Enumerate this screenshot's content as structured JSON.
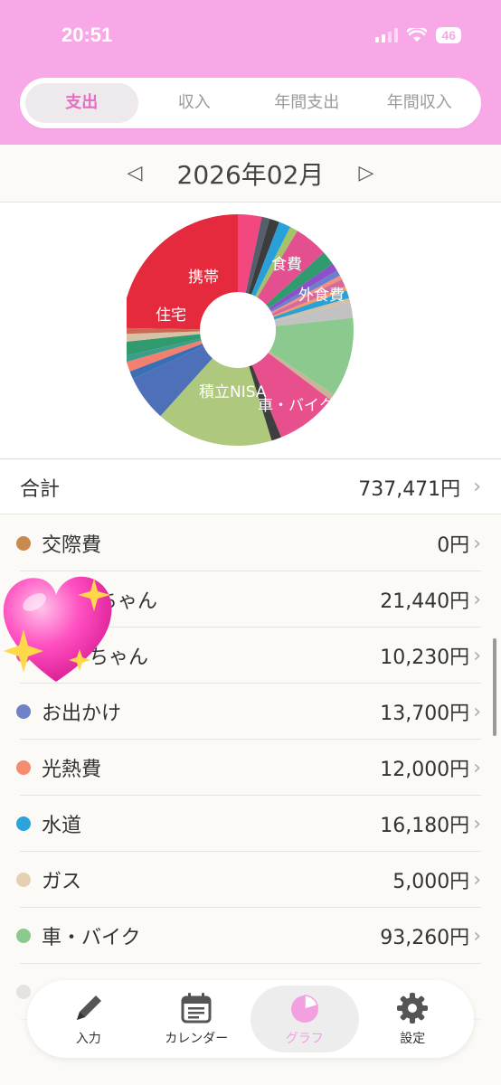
{
  "status": {
    "time": "20:51",
    "battery": "46"
  },
  "tabs": [
    {
      "label": "支出",
      "active": true
    },
    {
      "label": "収入",
      "active": false
    },
    {
      "label": "年間支出",
      "active": false
    },
    {
      "label": "年間収入",
      "active": false
    }
  ],
  "month": {
    "prev": "◁",
    "label": "2026年02月",
    "next": "▷"
  },
  "chart_data": {
    "type": "pie",
    "labels": [
      "食費",
      "外食費",
      "車・バイク",
      "積立NISA",
      "住宅",
      "携帯"
    ]
  },
  "total": {
    "label": "合計",
    "value": "737,471円"
  },
  "items": [
    {
      "name": "交際費",
      "amount": "0円",
      "color": "#c98a4e"
    },
    {
      "name": "ちゃん",
      "amount": "21,440円",
      "color": "#e05f9d"
    },
    {
      "name": "ちゃん",
      "amount": "10,230円",
      "color": "#e05f9d"
    },
    {
      "name": "お出かけ",
      "amount": "13,700円",
      "color": "#7083c8"
    },
    {
      "name": "光熱費",
      "amount": "12,000円",
      "color": "#f68b6e"
    },
    {
      "name": "水道",
      "amount": "16,180円",
      "color": "#2ca3dc"
    },
    {
      "name": "ガス",
      "amount": "5,000円",
      "color": "#e6d0b5"
    },
    {
      "name": "車・バイク",
      "amount": "93,260円",
      "color": "#8bc98f"
    }
  ],
  "nav": [
    {
      "label": "入力",
      "icon": "pencil-icon"
    },
    {
      "label": "カレンダー",
      "icon": "calendar-icon"
    },
    {
      "label": "グラフ",
      "icon": "pie-chart-icon"
    },
    {
      "label": "設定",
      "icon": "gear-icon"
    }
  ]
}
